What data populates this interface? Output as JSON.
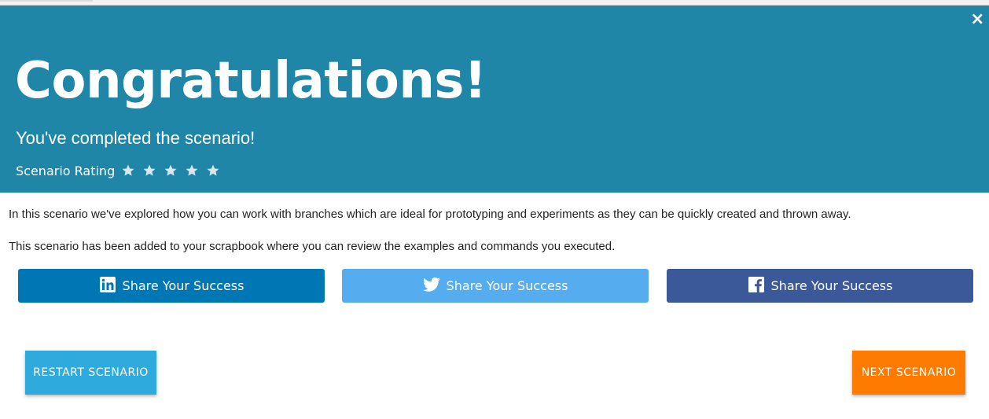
{
  "header": {
    "close_label": "×",
    "title": "Congratulations!",
    "subtitle": "You've completed the scenario!",
    "rating_label": "Scenario Rating",
    "stars": 5,
    "colors": {
      "background": "#1f86a8",
      "text": "#ffffff",
      "star": "#d9e6ec"
    }
  },
  "body": {
    "paragraph_1": "In this scenario we've explored how you can work with branches which are ideal for prototyping and experiments as they can be quickly created and thrown away.",
    "paragraph_2": "This scenario has been added to your scrapbook where you can review the examples and commands you executed."
  },
  "share": {
    "linkedin": {
      "label": "Share Your Success",
      "icon": "linkedin-icon",
      "color": "#0077b5"
    },
    "twitter": {
      "label": "Share Your Success",
      "icon": "twitter-icon",
      "color": "#55acee"
    },
    "facebook": {
      "label": "Share Your Success",
      "icon": "facebook-icon",
      "color": "#3b5998"
    }
  },
  "actions": {
    "restart_label": "RESTART SCENARIO",
    "next_label": "NEXT SCENARIO",
    "colors": {
      "restart": "#2eaadc",
      "next": "#ff7a00"
    }
  }
}
